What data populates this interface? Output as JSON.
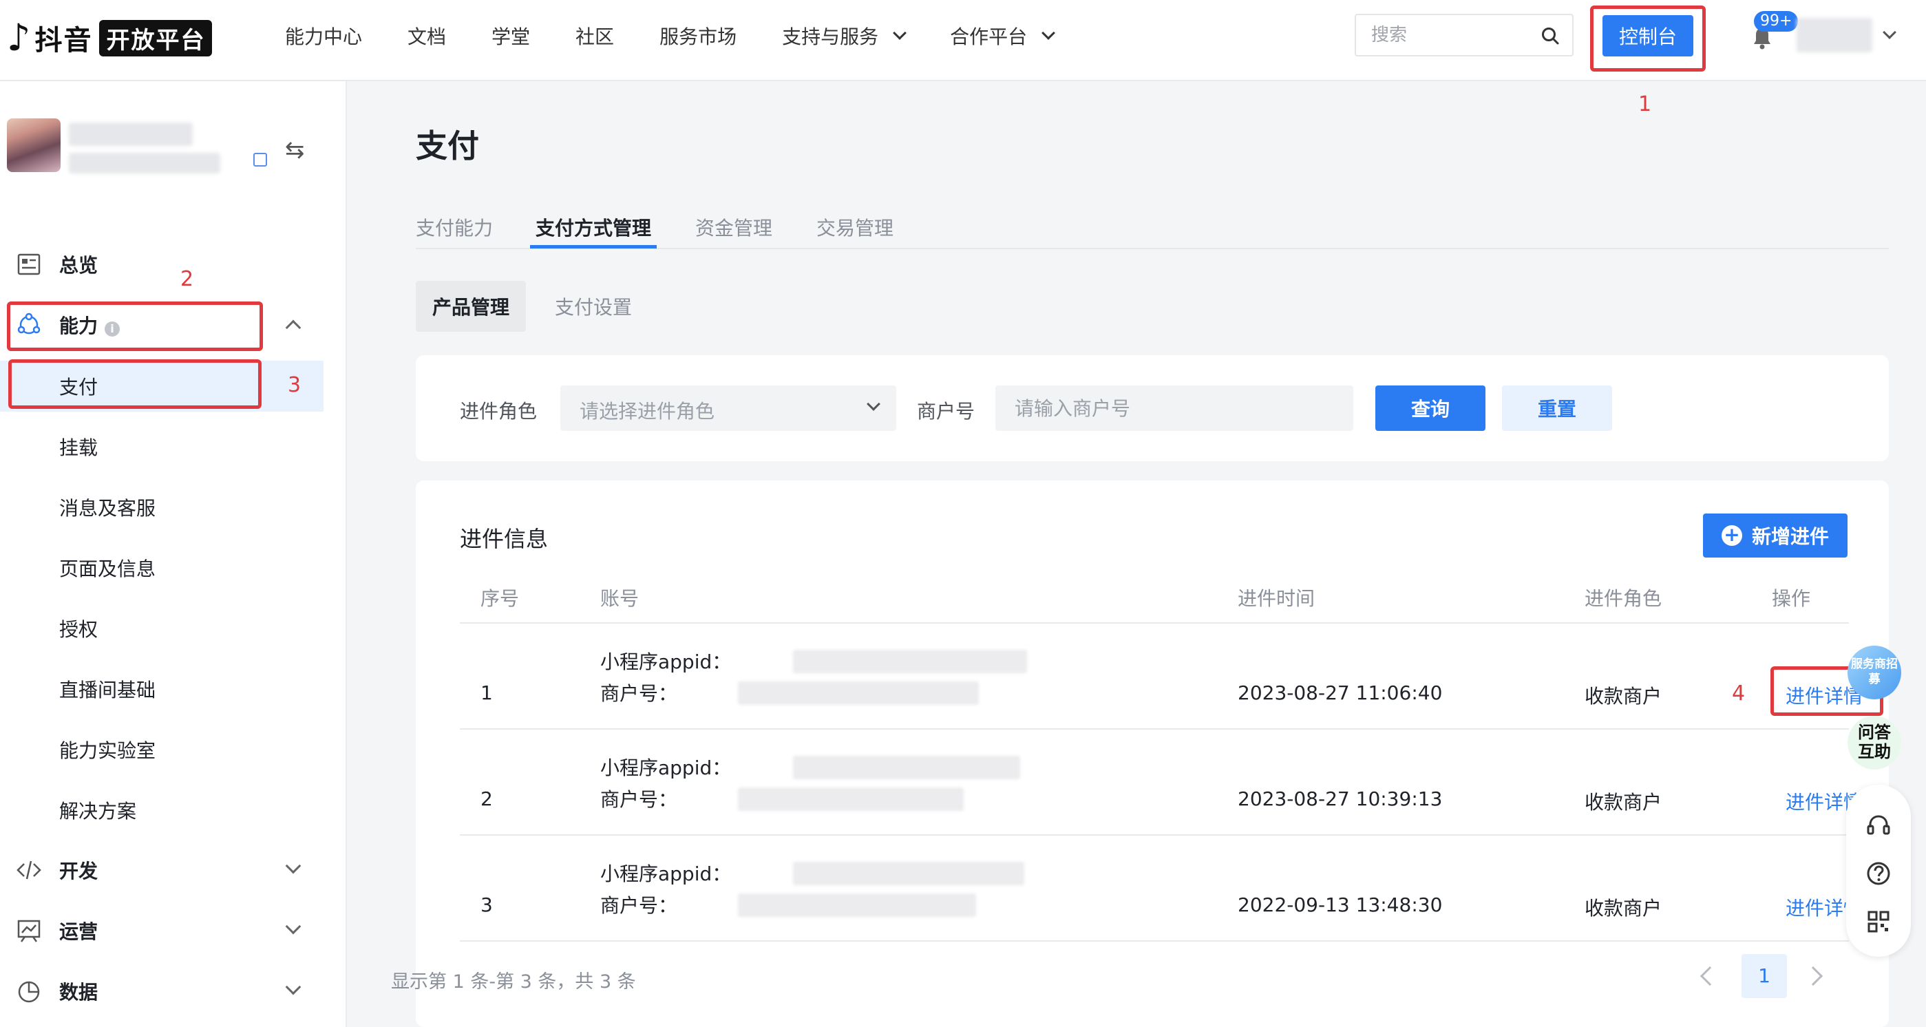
{
  "brand": {
    "logo_text": "抖音",
    "badge": "开放平台",
    "note_glyph": "♪"
  },
  "nav": {
    "items": [
      "能力中心",
      "文档",
      "学堂",
      "社区",
      "服务市场",
      "支持与服务",
      "合作平台"
    ]
  },
  "search": {
    "placeholder": "搜索"
  },
  "console_button": "控制台",
  "notifications": {
    "badge": "99+"
  },
  "annotations": [
    "1",
    "2",
    "3",
    "4"
  ],
  "sidebar": {
    "switch_glyph": "⇆",
    "overview": "总览",
    "ability": "能力",
    "ability_info": "i",
    "ability_children": [
      "支付",
      "挂载",
      "消息及客服",
      "页面及信息",
      "授权",
      "直播间基础",
      "能力实验室",
      "解决方案"
    ],
    "develop": "开发",
    "operate": "运营",
    "data": "数据"
  },
  "page": {
    "title": "支付"
  },
  "tabs": [
    "支付能力",
    "支付方式管理",
    "资金管理",
    "交易管理"
  ],
  "subtabs": [
    "产品管理",
    "支付设置"
  ],
  "filter": {
    "role_label": "进件角色",
    "role_placeholder": "请选择进件角色",
    "merchant_label": "商户号",
    "merchant_placeholder": "请输入商户号",
    "query": "查询",
    "reset": "重置"
  },
  "records": {
    "title": "进件信息",
    "add_button": "新增进件",
    "add_glyph": "+",
    "columns": [
      "序号",
      "账号",
      "进件时间",
      "进件角色",
      "操作"
    ],
    "appid_label": "小程序appid：",
    "merchant_label": "商户号：",
    "rows": [
      {
        "index": "1",
        "time": "2023-08-27 11:06:40",
        "role": "收款商户",
        "action": "进件详情"
      },
      {
        "index": "2",
        "time": "2023-08-27 10:39:13",
        "role": "收款商户",
        "action": "进件详情"
      },
      {
        "index": "3",
        "time": "2022-09-13 13:48:30",
        "role": "收款商户",
        "action": "进件详情"
      }
    ],
    "summary": "显示第 1 条-第 3 条，共 3 条",
    "current_page": "1"
  },
  "floating": {
    "recruit": "服务商招募",
    "qa": "问答互助"
  },
  "colors": {
    "accent": "#2b7bf2",
    "highlight": "#e0393e"
  }
}
